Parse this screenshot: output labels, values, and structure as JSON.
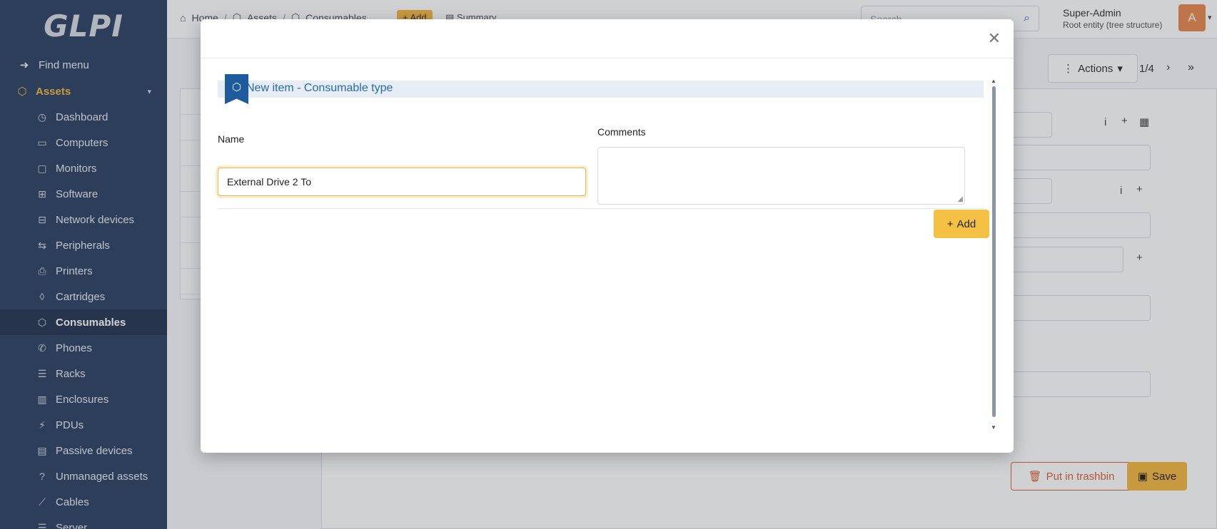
{
  "sidebar": {
    "logo": "GLPI",
    "find_menu": "Find menu",
    "section": "Assets",
    "items": [
      {
        "label": "Dashboard",
        "icon": "dashboard-icon"
      },
      {
        "label": "Computers",
        "icon": "laptop-icon"
      },
      {
        "label": "Monitors",
        "icon": "monitor-icon"
      },
      {
        "label": "Software",
        "icon": "apps-icon"
      },
      {
        "label": "Network devices",
        "icon": "network-icon"
      },
      {
        "label": "Peripherals",
        "icon": "usb-icon"
      },
      {
        "label": "Printers",
        "icon": "printer-icon"
      },
      {
        "label": "Cartridges",
        "icon": "droplet-icon"
      },
      {
        "label": "Consumables",
        "icon": "package-icon",
        "active": true
      },
      {
        "label": "Phones",
        "icon": "phone-icon"
      },
      {
        "label": "Racks",
        "icon": "server-icon"
      },
      {
        "label": "Enclosures",
        "icon": "columns-icon"
      },
      {
        "label": "PDUs",
        "icon": "plug-icon"
      },
      {
        "label": "Passive devices",
        "icon": "box-icon"
      },
      {
        "label": "Unmanaged assets",
        "icon": "question-icon"
      },
      {
        "label": "Cables",
        "icon": "cable-icon"
      },
      {
        "label": "Server",
        "icon": "server-icon"
      }
    ]
  },
  "header": {
    "breadcrumb": [
      "Home",
      "Assets",
      "Consumables"
    ],
    "add_label": "Add",
    "summary_label": "Summary",
    "search_placeholder": "Search",
    "user_name": "Super-Admin",
    "user_entity": "Root entity (tree structure)",
    "avatar_letter": "A"
  },
  "background": {
    "actions_label": "Actions",
    "pager": "1/4",
    "trash_label": "Put in trashbin",
    "save_label": "Save"
  },
  "modal": {
    "title": "New item - Consumable type",
    "name_label": "Name",
    "name_value": "External Drive 2 To",
    "comments_label": "Comments",
    "comments_value": "",
    "add_label": "Add"
  },
  "colors": {
    "sidebar_bg": "#2f4365",
    "accent_yellow": "#f4b942",
    "title_blue": "#2a6aa6",
    "danger_orange": "#d9653b"
  }
}
